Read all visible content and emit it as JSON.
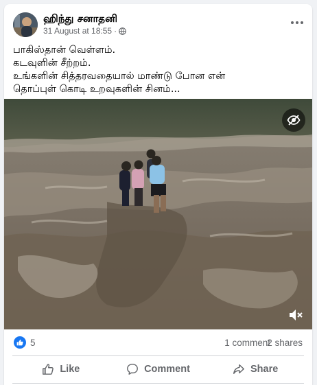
{
  "post": {
    "author": "ஹிந்து சனாதனி",
    "date": "31 August at 18:55",
    "separator": "·",
    "privacy_icon": "globe-icon",
    "more_icon": "more-options-icon",
    "text_lines": [
      "பாகிஸ்தான் வெள்ளம்.",
      "கடவுளின் சீற்றம்.",
      "உங்களின் சித்தரவதையால் மாண்டு போன என்",
      "தொப்புள் கொடி உறவுகளின் சினம்..."
    ]
  },
  "video": {
    "overlay_icon": "hidden-eye-icon",
    "sound_icon": "muted-speaker-icon"
  },
  "stats": {
    "like_count": "5",
    "comments": "1 comment",
    "shares": "2 shares"
  },
  "actions": {
    "like_label": "Like",
    "comment_label": "Comment",
    "share_label": "Share"
  },
  "colors": {
    "facebook_blue": "#1877f2",
    "secondary_text": "#65676b",
    "divider": "#ced0d4"
  }
}
